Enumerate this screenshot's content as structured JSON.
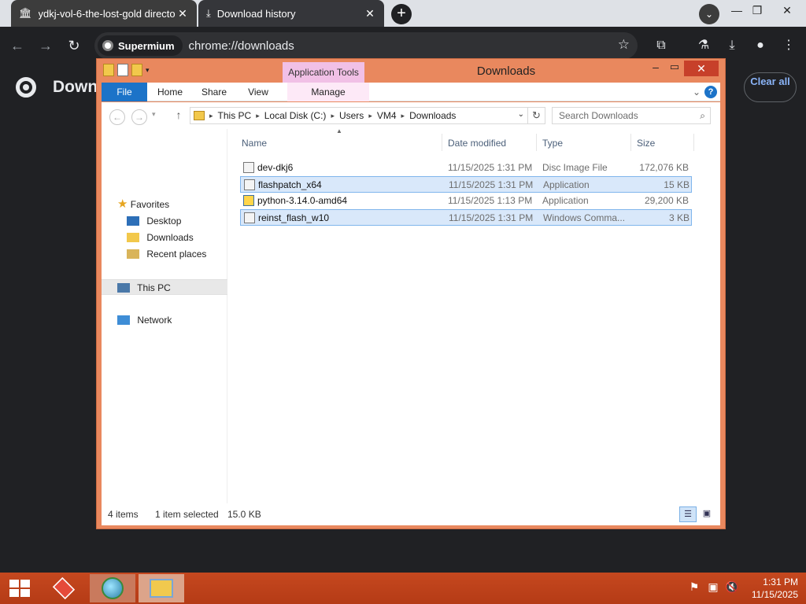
{
  "browser": {
    "tabs": [
      {
        "title": "ydkj-vol-6-the-lost-gold directo",
        "icon": "archive-icon"
      },
      {
        "title": "Download history",
        "icon": "download-icon"
      }
    ],
    "new_tab": "+",
    "address": {
      "chip": "Supermium",
      "url": "chrome://downloads"
    },
    "page_title": "Down",
    "clear_all": "Clear all"
  },
  "explorer": {
    "title": "Downloads",
    "context_tab": "Application Tools",
    "ribbon": {
      "file": "File",
      "home": "Home",
      "share": "Share",
      "view": "View",
      "manage": "Manage"
    },
    "breadcrumb": [
      "This PC",
      "Local Disk (C:)",
      "Users",
      "VM4",
      "Downloads"
    ],
    "search_placeholder": "Search Downloads",
    "nav": {
      "favorites": "Favorites",
      "desktop": "Desktop",
      "downloads": "Downloads",
      "recent": "Recent places",
      "this_pc": "This PC",
      "network": "Network"
    },
    "columns": {
      "name": "Name",
      "date": "Date modified",
      "type": "Type",
      "size": "Size"
    },
    "files": [
      {
        "name": "dev-dkj6",
        "date": "11/15/2025 1:31 PM",
        "type": "Disc Image File",
        "size": "172,076 KB"
      },
      {
        "name": "flashpatch_x64",
        "date": "11/15/2025 1:31 PM",
        "type": "Application",
        "size": "15 KB"
      },
      {
        "name": "python-3.14.0-amd64",
        "date": "11/15/2025 1:13 PM",
        "type": "Application",
        "size": "29,200 KB"
      },
      {
        "name": "reinst_flash_w10",
        "date": "11/15/2025 1:31 PM",
        "type": "Windows Comma...",
        "size": "3 KB"
      }
    ],
    "status": {
      "items": "4 items",
      "selected": "1 item selected",
      "size": "15.0 KB"
    }
  },
  "taskbar": {
    "time": "1:31 PM",
    "date": "11/15/2025"
  }
}
